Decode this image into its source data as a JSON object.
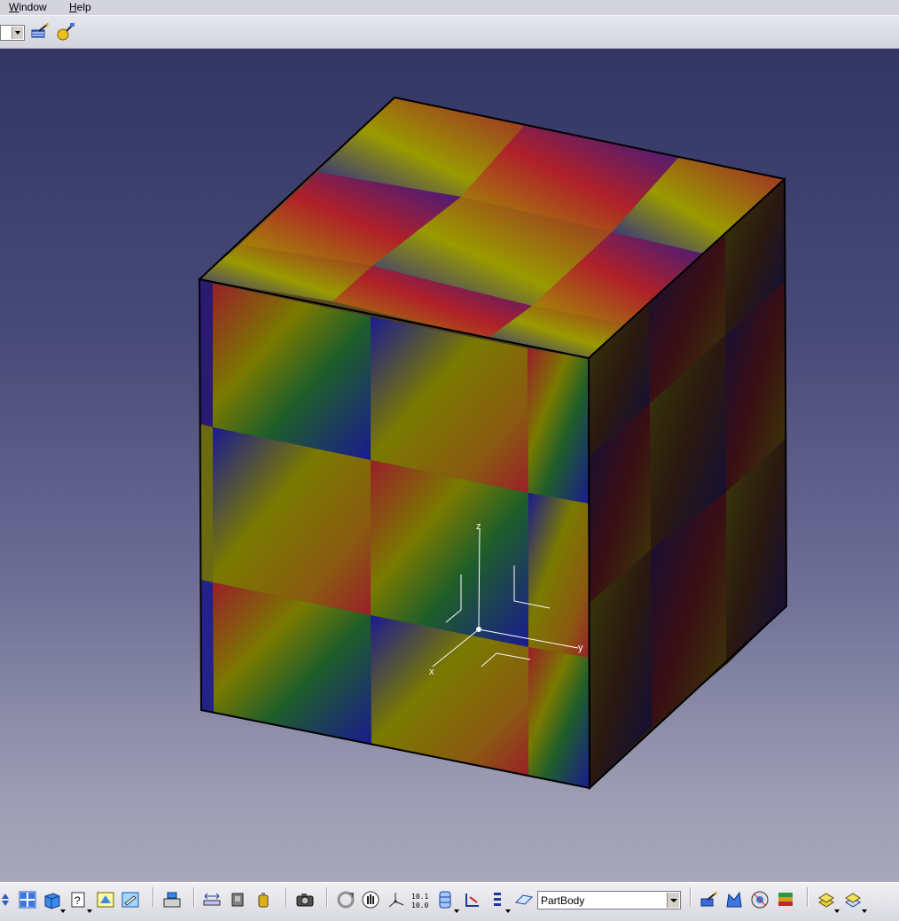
{
  "menubar": {
    "items": [
      {
        "label": "Window",
        "accel": "W",
        "rest": "indow"
      },
      {
        "label": "Help",
        "accel": "H",
        "rest": "elp"
      }
    ]
  },
  "top_toolbar": {
    "icons": [
      "apply-material-icon",
      "material-library-icon"
    ]
  },
  "viewport": {
    "axes": {
      "x": "x",
      "y": "y",
      "z": "z"
    },
    "colors": {
      "bg_top": "#333664",
      "bg_bottom": "#a8a8ba",
      "checker_red": "#8a1a20",
      "checker_yellow": "#7c7c00",
      "checker_blue": "#1a1a8c",
      "checker_green": "#1c5c1c"
    }
  },
  "bottom_toolbar": {
    "tool_icons": [
      "pan-arrows-icon",
      "multi-view-icon",
      "iso-view-icon",
      "view-mode-icon",
      "shading-icon",
      "hide-show-icon",
      "swap-visible-icon",
      "measure-between-icon",
      "measure-item-icon",
      "measure-inertia-icon",
      "capture-icon",
      "update-icon",
      "manipulate-icon",
      "axis-system-icon",
      "dimensions-icon",
      "sketch-analysis-icon",
      "constraints-icon",
      "options-icon",
      "plane-icon"
    ],
    "part_combo_value": "PartBody",
    "right_icons": [
      "apply-material-icon",
      "render-icon",
      "scene-icon",
      "environment-icon",
      "catalog-icon",
      "insert-icon"
    ]
  }
}
